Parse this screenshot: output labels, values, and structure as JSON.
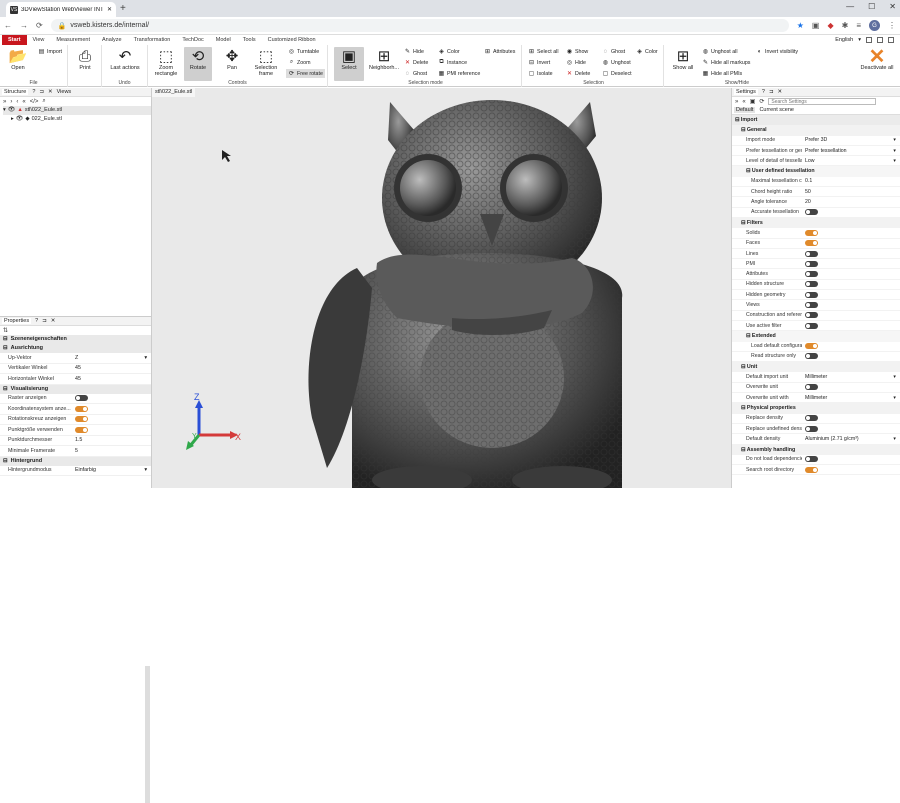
{
  "browser": {
    "tab_title": "3DViewStation WebViewer INTE",
    "url": "vsweb.kisters.de/internal/",
    "favicon": "VS",
    "avatar": "G"
  },
  "ribbon_tabs": [
    "Start",
    "View",
    "Measurement",
    "Analyze",
    "Transformation",
    "TechDoc",
    "Model",
    "Tools",
    "Customized Ribbon"
  ],
  "language": "English",
  "groups": {
    "file": "File",
    "undo": "Undo",
    "controls": "Controls",
    "selection_mode": "Selection mode",
    "selection": "Selection",
    "show_hide": "Show/Hide"
  },
  "buttons": {
    "open": "Open",
    "import": "Import",
    "print": "Print",
    "last_actions": "Last actions",
    "zoom_rectangle": "Zoom rectangle",
    "rotate": "Rotate",
    "pan": "Pan",
    "selection_frame": "Selection frame",
    "turntable": "Turntable",
    "zoom": "Zoom",
    "free_rotate": "Free rotate",
    "select": "Select",
    "neighborhood": "Neighborh...",
    "hide": "Hide",
    "delete": "Delete",
    "ghost": "Ghost",
    "color": "Color",
    "instance": "Instance",
    "pmi_reference": "PMI reference",
    "attributes": "Attributes",
    "select_all": "Select all",
    "invert": "Invert",
    "isolate": "Isolate",
    "show": "Show",
    "hide2": "Hide",
    "delete2": "Delete",
    "ghost2": "Ghost",
    "unghost": "Unghost",
    "deselect": "Deselect",
    "color2": "Color",
    "show_all": "Show all",
    "unghost_all": "Unghost all",
    "hide_all_markups": "Hide all markups",
    "hide_all_pmis": "Hide all PMIs",
    "invert_visibility": "Invert visibility",
    "deactivate_all": "Deactivate all"
  },
  "structure": {
    "tab1": "Structure",
    "tab2": "Views",
    "items": [
      "stl\\022_Eule.stl",
      "022_Eule.stl"
    ]
  },
  "viewport": {
    "tab": "stl\\022_Eule.stl",
    "axis_x": "X",
    "axis_y": "Y",
    "axis_z": "Z"
  },
  "properties": {
    "title": "Properties",
    "rows": [
      {
        "type": "sec",
        "label": "Szeneneigenschaften"
      },
      {
        "type": "sec",
        "label": "Ausrichtung"
      },
      {
        "type": "sel",
        "k": "Up-Vektor",
        "v": "Z"
      },
      {
        "type": "txt",
        "k": "Vertikaler Winkel",
        "v": "45"
      },
      {
        "type": "txt",
        "k": "Horizontaler Winkel",
        "v": "45"
      },
      {
        "type": "sec",
        "label": "Visualisierung"
      },
      {
        "type": "tog",
        "k": "Raster anzeigen",
        "v": false
      },
      {
        "type": "tog",
        "k": "Koordinatensystem anze...",
        "v": true
      },
      {
        "type": "tog",
        "k": "Rotationskreuz anzeigen",
        "v": true
      },
      {
        "type": "tog",
        "k": "Punktgröße verwenden",
        "v": true
      },
      {
        "type": "txt",
        "k": "Punktdurchmesser",
        "v": "1.5"
      },
      {
        "type": "txt",
        "k": "Minimale Framerate",
        "v": "5"
      },
      {
        "type": "sec",
        "label": "Hintergrund"
      },
      {
        "type": "sel",
        "k": "Hintergrundmodus",
        "v": "Einfarbig"
      }
    ]
  },
  "settings": {
    "title": "Settings",
    "search_placeholder": "Search Settings",
    "tab1": "Default",
    "tab2": "Current scene",
    "rows": [
      {
        "t": "s1",
        "label": "Import"
      },
      {
        "t": "s2",
        "label": "General"
      },
      {
        "t": "sel",
        "k": "Import mode",
        "v": "Prefer 3D"
      },
      {
        "t": "sel",
        "k": "Prefer tessellation or geo...",
        "v": "Prefer tessellation"
      },
      {
        "t": "sel",
        "k": "Level of detail of tessellation",
        "v": "Low"
      },
      {
        "t": "s3",
        "label": "User defined tessellation"
      },
      {
        "t": "txt2",
        "k": "Maximal tessellation ch...",
        "v": "0.1"
      },
      {
        "t": "txt2",
        "k": "Chord height ratio",
        "v": "50"
      },
      {
        "t": "txt2",
        "k": "Angle tolerance",
        "v": "20"
      },
      {
        "t": "tog2",
        "k": "Accurate tessellation",
        "v": false
      },
      {
        "t": "s2",
        "label": "Filters"
      },
      {
        "t": "tog",
        "k": "Solids",
        "v": true
      },
      {
        "t": "tog",
        "k": "Faces",
        "v": true
      },
      {
        "t": "tog",
        "k": "Lines",
        "v": false
      },
      {
        "t": "tog",
        "k": "PMI",
        "v": false
      },
      {
        "t": "tog",
        "k": "Attributes",
        "v": false
      },
      {
        "t": "tog",
        "k": "Hidden structure",
        "v": false
      },
      {
        "t": "tog",
        "k": "Hidden geometry",
        "v": false
      },
      {
        "t": "tog",
        "k": "Views",
        "v": false
      },
      {
        "t": "tog",
        "k": "Construction and references",
        "v": false
      },
      {
        "t": "tog",
        "k": "Use active filter",
        "v": false
      },
      {
        "t": "s3",
        "label": "Extended"
      },
      {
        "t": "tog2",
        "k": "Load default configuration",
        "v": true
      },
      {
        "t": "tog2",
        "k": "Read structure only",
        "v": false
      },
      {
        "t": "s2",
        "label": "Unit"
      },
      {
        "t": "sel",
        "k": "Default import unit",
        "v": "Millimeter"
      },
      {
        "t": "tog",
        "k": "Overwrite unit",
        "v": false
      },
      {
        "t": "sel",
        "k": "Overwrite unit with",
        "v": "Millimeter"
      },
      {
        "t": "s2",
        "label": "Physical properties"
      },
      {
        "t": "tog",
        "k": "Replace density",
        "v": false
      },
      {
        "t": "tog",
        "k": "Replace undefined densities",
        "v": false
      },
      {
        "t": "sel",
        "k": "Default density",
        "v": "Aluminium (2.71 g/cm³)"
      },
      {
        "t": "s2",
        "label": "Assembly handling"
      },
      {
        "t": "tog",
        "k": "Do not load dependencies",
        "v": false
      },
      {
        "t": "tog",
        "k": "Search root directory",
        "v": true
      }
    ]
  }
}
